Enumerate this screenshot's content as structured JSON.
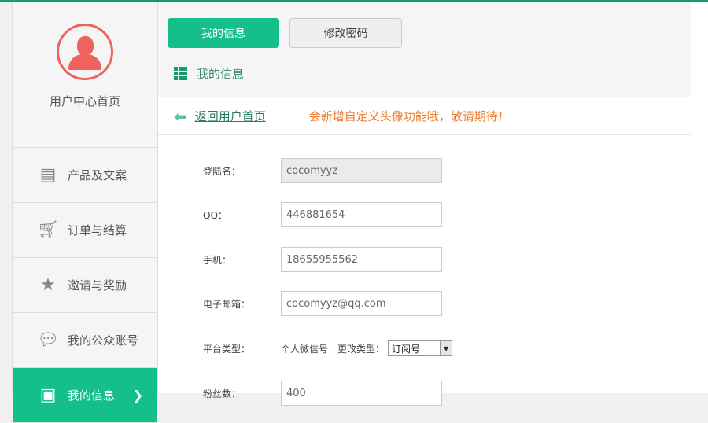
{
  "sidebar": {
    "home_label": "用户中心首页",
    "items": [
      {
        "label": "产品及文案",
        "icon": "archive-icon"
      },
      {
        "label": "订单与结算",
        "icon": "cart-icon"
      },
      {
        "label": "邀请与奖励",
        "icon": "star-icon"
      },
      {
        "label": "我的公众账号",
        "icon": "wechat-icon"
      },
      {
        "label": "我的信息",
        "icon": "contacts-icon",
        "chevron": "❯"
      }
    ]
  },
  "tabs": {
    "my_info": "我的信息",
    "change_password": "修改密码"
  },
  "section_title": "我的信息",
  "back_link": "返回用户首页",
  "notice": "会新增自定义头像功能哦，敬请期待！",
  "form": {
    "username_label": "登陆名：",
    "username": "cocomyyz",
    "qq_label": "QQ：",
    "qq": "446881654",
    "phone_label": "手机：",
    "phone": "18655955562",
    "email_label": "电子邮箱：",
    "email": "cocomyyz@qq.com",
    "platform_label": "平台类型：",
    "platform": "个人微信号",
    "change_type_label": "更改类型：",
    "change_type": "订阅号",
    "fans_label": "粉丝数：",
    "fans": "400"
  },
  "colors": {
    "accent": "#14bf8c",
    "avatar": "#f0625e",
    "notice": "#f07a2a"
  }
}
